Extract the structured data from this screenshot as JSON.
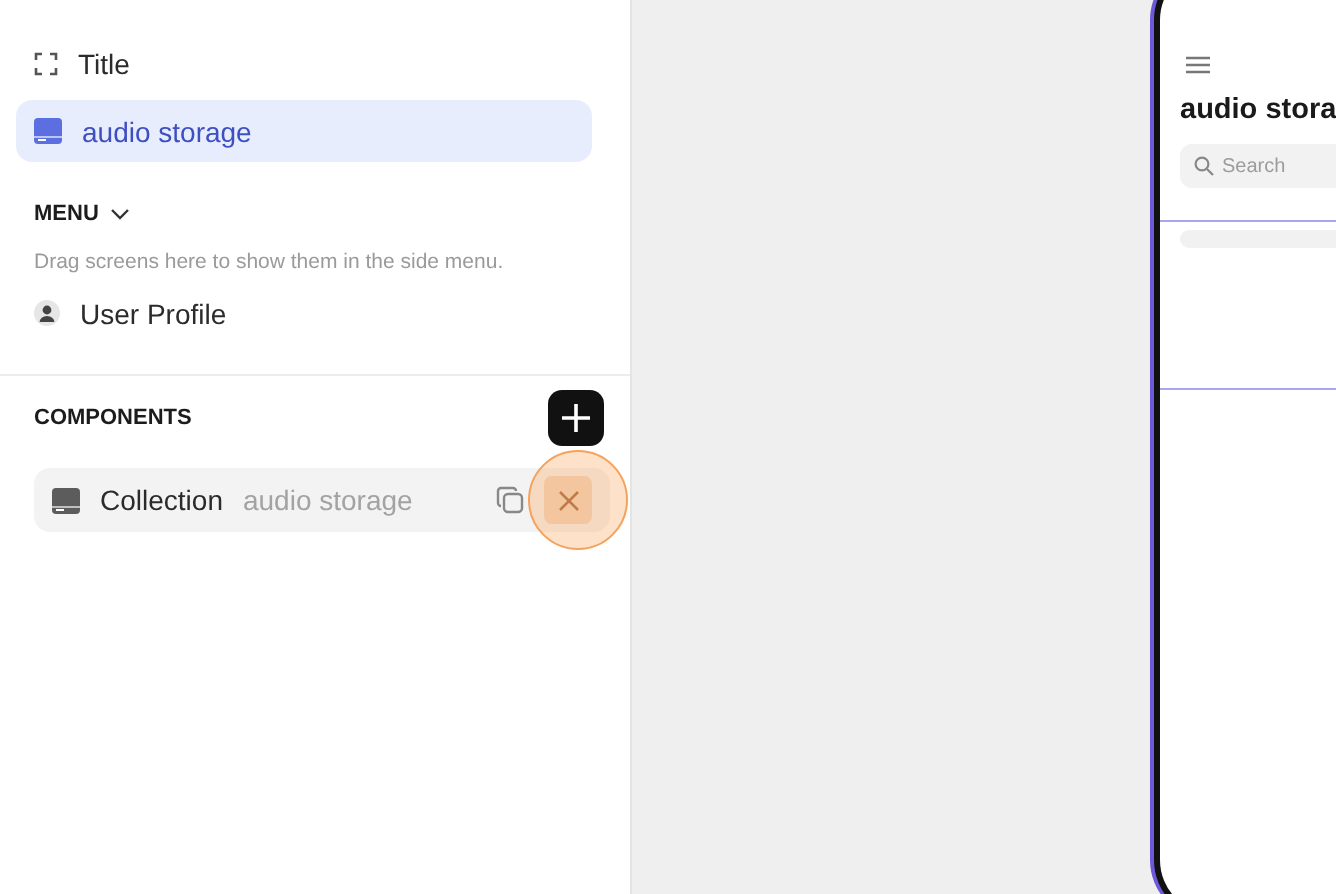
{
  "sidebar": {
    "screen_items": [
      {
        "kind": "title",
        "label": "Title",
        "selected": false
      },
      {
        "kind": "collection",
        "label": "audio storage",
        "selected": true
      }
    ],
    "menu": {
      "heading": "MENU",
      "expanded": true,
      "hint": "Drag screens here to show them in the side menu.",
      "items": [
        {
          "label": "User Profile"
        }
      ]
    },
    "components": {
      "heading": "COMPONENTS",
      "items": [
        {
          "name": "Collection",
          "source": "audio storage",
          "hovered": true
        }
      ]
    }
  },
  "phone": {
    "title": "audio stora",
    "search": {
      "placeholder": "Search"
    }
  }
}
